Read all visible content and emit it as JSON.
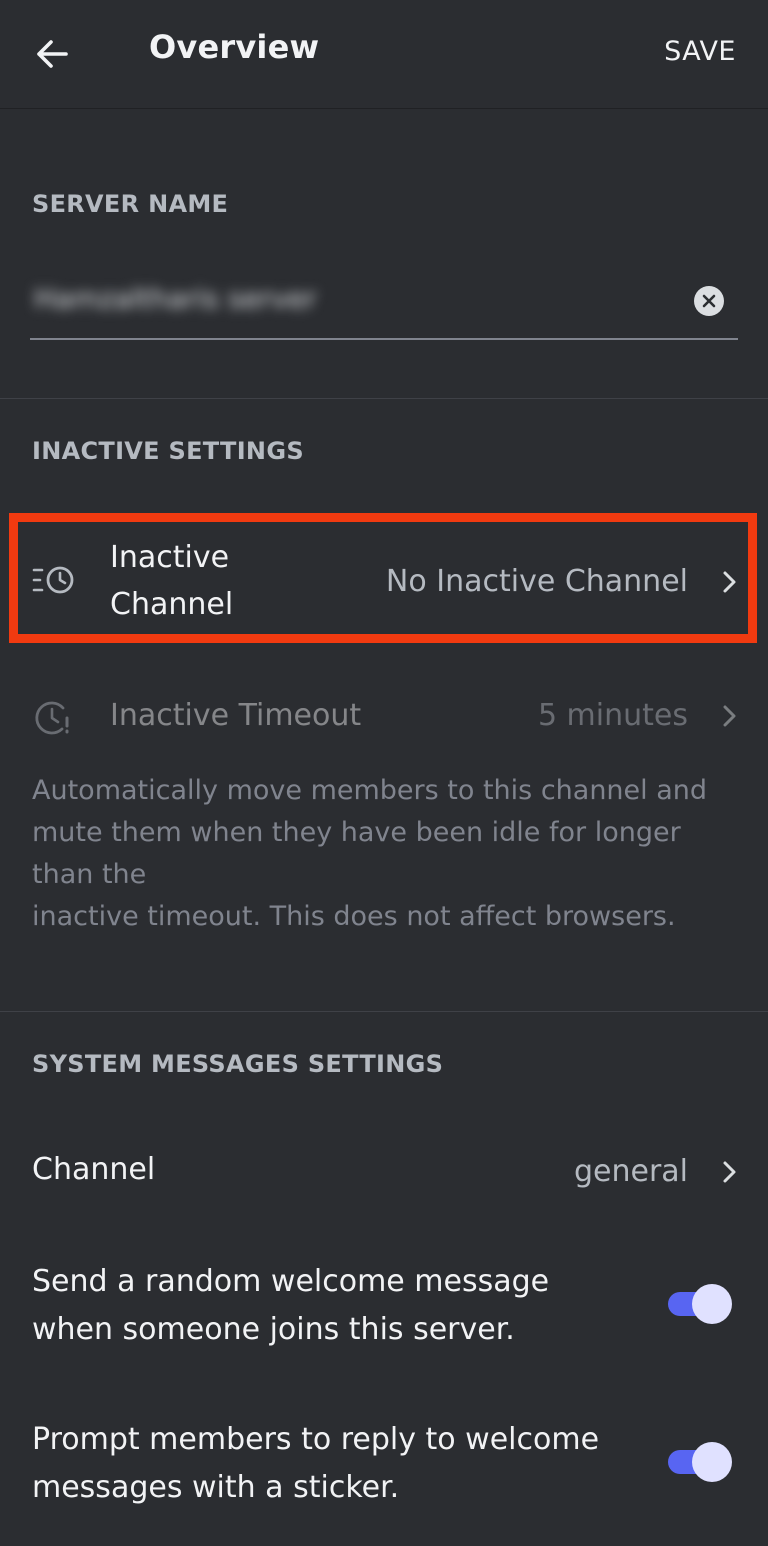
{
  "header": {
    "title": "Overview",
    "save_label": "SAVE",
    "back_icon": "arrow-left-icon"
  },
  "server_name": {
    "section_label": "SERVER NAME",
    "value": "Hamzaltharis server",
    "clear_icon": "clear-circle-icon"
  },
  "inactive": {
    "section_label": "INACTIVE SETTINGS",
    "channel": {
      "label": "Inactive\nChannel",
      "value": "No Inactive Channel",
      "icon": "inactive-channel-icon"
    },
    "timeout": {
      "label": "Inactive Timeout",
      "value": "5 minutes",
      "icon": "inactive-timeout-icon"
    },
    "helper": "Automatically move members to this channel and mute them when they have been idle for longer than the\ninactive timeout. This does not affect browsers."
  },
  "system_messages": {
    "section_label": "SYSTEM MESSAGES SETTINGS",
    "channel": {
      "label": "Channel",
      "value": "general"
    },
    "welcome_toggle": {
      "label": "Send a random welcome message when someone joins this server.",
      "enabled": true
    },
    "sticker_toggle": {
      "label": "Prompt members to reply to welcome messages with a sticker.",
      "enabled": true
    }
  },
  "colors": {
    "background": "#2b2d31",
    "accent": "#5865f2",
    "highlight": "#f13a10",
    "muted_text": "#b5bac1"
  }
}
